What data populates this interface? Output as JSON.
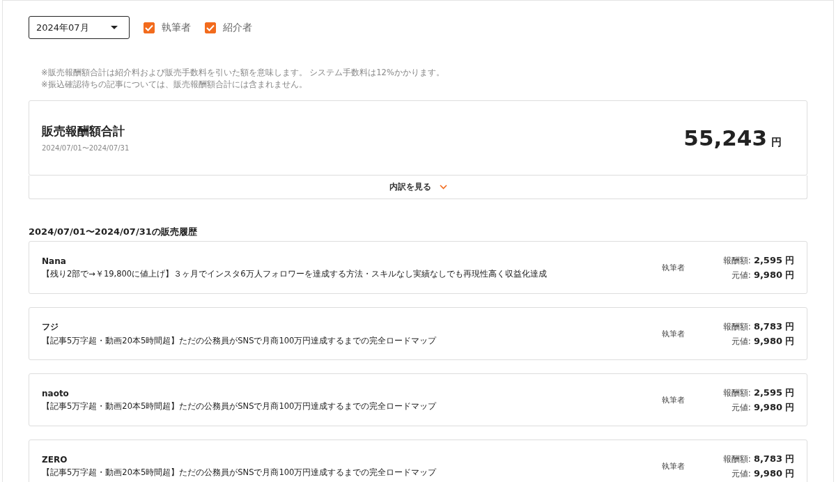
{
  "filter": {
    "month": "2024年07月",
    "roles": [
      {
        "label": "執筆者",
        "checked": true
      },
      {
        "label": "紹介者",
        "checked": true
      }
    ]
  },
  "notes": [
    "※販売報酬額合計は紹介料および販売手数料を引いた額を意味します。 システム手数料は12%かかります。",
    "※振込確認待ちの記事については、販売報酬額合計には含まれません。"
  ],
  "summary": {
    "title": "販売報酬額合計",
    "period": "2024/07/01〜2024/07/31",
    "total": "55,243",
    "unit": "円"
  },
  "breakdown": {
    "label": "内訳を見る",
    "expanded": false
  },
  "history": {
    "title": "2024/07/01〜2024/07/31の販売履歴",
    "rows": [
      {
        "buyer": "Nana",
        "article": "【残り2部で→￥19,800に値上げ】３ヶ月でインスタ6万人フォロワーを達成する方法・スキルなし実績なしでも再現性高く収益化達成",
        "role": "執筆者",
        "reward_label": "報酬額:",
        "reward": "2,595",
        "reward_unit": "円",
        "price_label": "元値:",
        "price": "9,980",
        "price_unit": "円"
      },
      {
        "buyer": "フジ",
        "article": "【記事5万字超・動画20本5時間超】ただの公務員がSNSで月商100万円達成するまでの完全ロードマップ",
        "role": "執筆者",
        "reward_label": "報酬額:",
        "reward": "8,783",
        "reward_unit": "円",
        "price_label": "元値:",
        "price": "9,980",
        "price_unit": "円"
      },
      {
        "buyer": "naoto",
        "article": "【記事5万字超・動画20本5時間超】ただの公務員がSNSで月商100万円達成するまでの完全ロードマップ",
        "role": "執筆者",
        "reward_label": "報酬額:",
        "reward": "2,595",
        "reward_unit": "円",
        "price_label": "元値:",
        "price": "9,980",
        "price_unit": "円"
      },
      {
        "buyer": "ZERO",
        "article": "【記事5万字超・動画20本5時間超】ただの公務員がSNSで月商100万円達成するまでの完全ロードマップ",
        "role": "執筆者",
        "reward_label": "報酬額:",
        "reward": "8,783",
        "reward_unit": "円",
        "price_label": "元値:",
        "price": "9,980",
        "price_unit": "円"
      }
    ]
  }
}
